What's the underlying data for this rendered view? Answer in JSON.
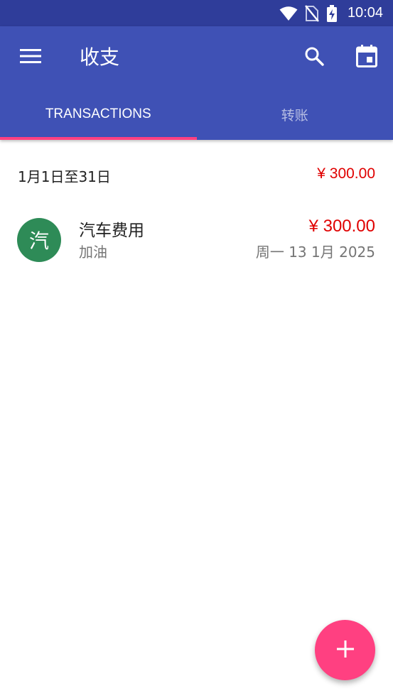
{
  "status_bar": {
    "time": "10:04",
    "icons": [
      "wifi-icon",
      "no-sim-icon",
      "battery-charging-icon"
    ]
  },
  "app_bar": {
    "title": "收支",
    "icons": {
      "menu": "menu-icon",
      "search": "search-icon",
      "calendar": "calendar-icon"
    },
    "background": "#3f51b5"
  },
  "tabs": [
    {
      "label": "TRANSACTIONS",
      "active": true
    },
    {
      "label": "转账",
      "active": false
    }
  ],
  "period": {
    "label": "1月1日至31日",
    "total": "¥ 300.00"
  },
  "transactions": [
    {
      "avatar_text": "汽",
      "category": "汽车费用",
      "note": "加油",
      "amount": "¥ 300.00",
      "date": "周一 13 1月 2025",
      "avatar_color": "#2e8b57"
    }
  ],
  "fab": {
    "icon": "plus-icon"
  },
  "colors": {
    "accent": "#ff4081",
    "expense": "#e00000",
    "status_bar": "#2f3d9a"
  }
}
